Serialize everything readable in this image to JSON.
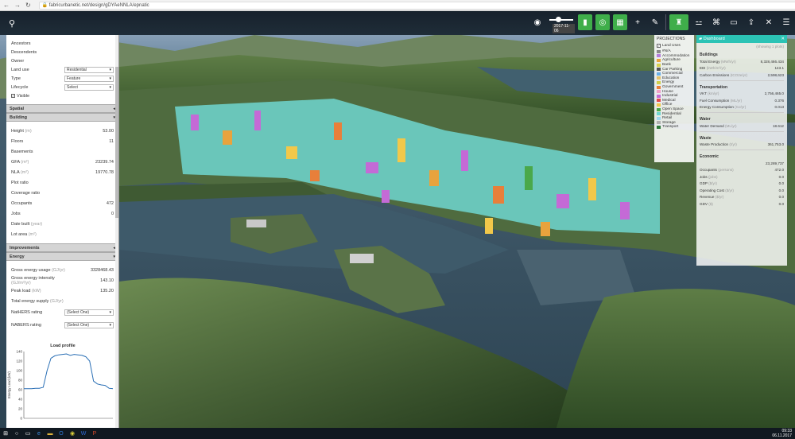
{
  "browser": {
    "url": "fabricurbanetic.net/design/gDYAeNNLA/epnatic"
  },
  "toolbar": {
    "date_label": "2017-11-06"
  },
  "left_panel": {
    "top_rows": [
      {
        "label": "Ancestors"
      },
      {
        "label": "Descendents"
      },
      {
        "label": "Owner"
      }
    ],
    "land_use": {
      "label": "Land use",
      "value": "Residential"
    },
    "type": {
      "label": "Type",
      "value": "Feature"
    },
    "lifecycle": {
      "label": "Lifecycle",
      "value": "Select"
    },
    "visible_label": "Visible",
    "spatial_header": "Spatial",
    "building_header": "Building",
    "building_rows": [
      {
        "label": "Height",
        "unit": "(m)",
        "value": "53.00"
      },
      {
        "label": "Floors",
        "unit": "",
        "value": "11"
      },
      {
        "label": "Basements",
        "unit": "",
        "value": ""
      },
      {
        "label": "GFA",
        "unit": "(m²)",
        "value": "23239.74"
      },
      {
        "label": "NLA",
        "unit": "(m²)",
        "value": "19770.78"
      },
      {
        "label": "Plot ratio",
        "unit": "",
        "value": ""
      },
      {
        "label": "Coverage ratio",
        "unit": "",
        "value": ""
      },
      {
        "label": "Occupants",
        "unit": "",
        "value": "472"
      },
      {
        "label": "Jobs",
        "unit": "",
        "value": "0"
      },
      {
        "label": "Date built",
        "unit": "(year)",
        "value": ""
      },
      {
        "label": "Lot area",
        "unit": "(m²)",
        "value": ""
      }
    ],
    "improvements_header": "Improvements",
    "energy_header": "Energy",
    "energy_rows": [
      {
        "label": "Gross energy usage",
        "unit": "(GJ/yr)",
        "value": "3328468.43"
      },
      {
        "label": "Gross energy intensity",
        "unit": "(GJ/m²/yr)",
        "value": "143.10"
      },
      {
        "label": "Peak load",
        "unit": "(kW)",
        "value": "135.20"
      },
      {
        "label": "Total energy supply",
        "unit": "(GJ/yr)",
        "value": ""
      }
    ],
    "nathers": {
      "label": "NatHERS rating",
      "value": "(Select One)"
    },
    "nabers": {
      "label": "NABERS rating",
      "value": "(Select One)"
    }
  },
  "chart_data": {
    "type": "line",
    "title": "Load profile",
    "ylabel": "Energy Load (kW)",
    "xlabel": "",
    "ylim": [
      0,
      140
    ],
    "yticks": [
      0,
      20,
      40,
      60,
      80,
      100,
      120,
      140
    ],
    "x": [
      0,
      1,
      2,
      3,
      4,
      5,
      6,
      7,
      8,
      9,
      10,
      11,
      12,
      13,
      14,
      15,
      16,
      17,
      18,
      19,
      20,
      21,
      22,
      23
    ],
    "series": [
      {
        "values": [
          62,
          62,
          62,
          63,
          63,
          65,
          100,
          126,
          131,
          133,
          134,
          135,
          132,
          134,
          133,
          132,
          129,
          120,
          78,
          72,
          70,
          69,
          63,
          62
        ]
      }
    ],
    "line_color": "#2a6fb5"
  },
  "projections": {
    "title": "PROJECTIONS",
    "land_uses_label": "Land Uses",
    "items": [
      {
        "label": "#N/A",
        "color": "#8a8a8a"
      },
      {
        "label": "Accommodation",
        "color": "#b57edc"
      },
      {
        "label": "Agriculture",
        "color": "#e8a33d"
      },
      {
        "label": "Bank",
        "color": "#d9d24f"
      },
      {
        "label": "Car Parking",
        "color": "#555555"
      },
      {
        "label": "Commercial",
        "color": "#6ab0e6"
      },
      {
        "label": "Education",
        "color": "#e6c36a"
      },
      {
        "label": "Energy",
        "color": "#cfcf4a"
      },
      {
        "label": "Government",
        "color": "#e87f3a"
      },
      {
        "label": "House",
        "color": "#f0a0c8"
      },
      {
        "label": "Industrial",
        "color": "#c46ad6"
      },
      {
        "label": "Medical",
        "color": "#e04a4a"
      },
      {
        "label": "Office",
        "color": "#f2c84a"
      },
      {
        "label": "Open Space",
        "color": "#4aa84a"
      },
      {
        "label": "Residential",
        "color": "#6fd6d0"
      },
      {
        "label": "Retail",
        "color": "#a0d8f0"
      },
      {
        "label": "Storage",
        "color": "#b0b0b0"
      },
      {
        "label": "Transport",
        "color": "#2d7a3a"
      }
    ]
  },
  "dashboard": {
    "title": "Dashboard",
    "subtitle": "(showing 1 plots)",
    "sections": [
      {
        "name": "Buildings",
        "rows": [
          {
            "label": "Total Energy",
            "unit": "(MWh/yr)",
            "value": "8,328,466.434"
          },
          {
            "label": "EEI",
            "unit": "(kWh/m²/yr)",
            "value": "143.1"
          },
          {
            "label": "Carbon Emissions",
            "unit": "(tCO2e/yr)",
            "value": "2,598,623"
          }
        ]
      },
      {
        "name": "Transportation",
        "rows": [
          {
            "label": "VKT",
            "unit": "(km/yr)",
            "value": "2,756,465.0"
          },
          {
            "label": "Fuel Consumption",
            "unit": "(ML/yr)",
            "value": "0.376"
          },
          {
            "label": "Energy Consumption",
            "unit": "(GJ/yr)",
            "value": "0.013"
          }
        ]
      },
      {
        "name": "Water",
        "rows": [
          {
            "label": "Water Demand",
            "unit": "(ML/yr)",
            "value": "18.612"
          }
        ]
      },
      {
        "name": "Waste",
        "rows": [
          {
            "label": "Waste Production",
            "unit": "(t/yr)",
            "value": "361,753.0"
          }
        ]
      },
      {
        "name": "Economic",
        "rows": [
          {
            "label": "",
            "unit": "",
            "value": "23,289,737"
          },
          {
            "label": "Occupants",
            "unit": "(persons)",
            "value": "472.0"
          },
          {
            "label": "Jobs",
            "unit": "(jobs)",
            "value": "0.0"
          },
          {
            "label": "GDP",
            "unit": "($/yr)",
            "value": "0.0"
          },
          {
            "label": "Operating Cost",
            "unit": "($/yr)",
            "value": "0.0"
          },
          {
            "label": "Revenue",
            "unit": "($/yr)",
            "value": "0.0"
          },
          {
            "label": "GDV",
            "unit": "($)",
            "value": "0.0"
          }
        ]
      }
    ]
  },
  "taskbar": {
    "time": "09:33",
    "date": "06.11.2017"
  }
}
